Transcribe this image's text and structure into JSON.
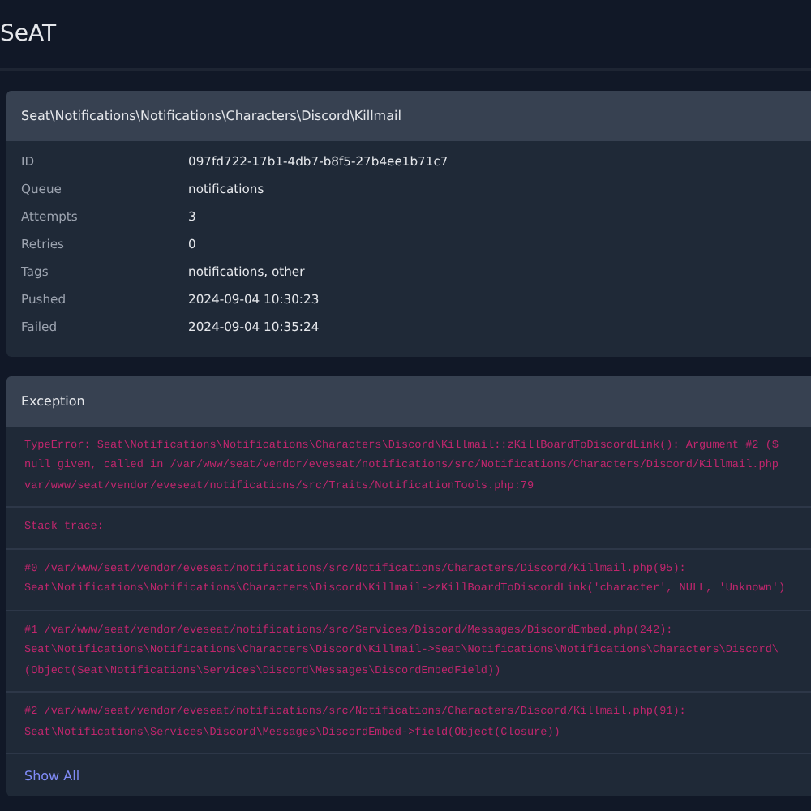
{
  "app_title": "SeAT",
  "job": {
    "title": "Seat\\Notifications\\Notifications\\Characters\\Discord\\Killmail",
    "details": [
      {
        "label": "ID",
        "value": "097fd722-17b1-4db7-b8f5-27b4ee1b71c7"
      },
      {
        "label": "Queue",
        "value": "notifications"
      },
      {
        "label": "Attempts",
        "value": "3"
      },
      {
        "label": "Retries",
        "value": "0"
      },
      {
        "label": "Tags",
        "value": "notifications, other"
      },
      {
        "label": "Pushed",
        "value": "2024-09-04 10:30:23"
      },
      {
        "label": "Failed",
        "value": "2024-09-04 10:35:24"
      }
    ]
  },
  "exception": {
    "title": "Exception",
    "message": [
      "TypeError: Seat\\Notifications\\Notifications\\Characters\\Discord\\Killmail::zKillBoardToDiscordLink(): Argument #2 ($",
      "null given, called in /var/www/seat/vendor/eveseat/notifications/src/Notifications/Characters/Discord/Killmail.php",
      "var/www/seat/vendor/eveseat/notifications/src/Traits/NotificationTools.php:79"
    ],
    "stack_label": "Stack trace:",
    "frames": [
      [
        "#0 /var/www/seat/vendor/eveseat/notifications/src/Notifications/Characters/Discord/Killmail.php(95):",
        "Seat\\Notifications\\Notifications\\Characters\\Discord\\Killmail->zKillBoardToDiscordLink('character', NULL, 'Unknown')"
      ],
      [
        "#1 /var/www/seat/vendor/eveseat/notifications/src/Services/Discord/Messages/DiscordEmbed.php(242):",
        "Seat\\Notifications\\Notifications\\Characters\\Discord\\Killmail->Seat\\Notifications\\Notifications\\Characters\\Discord\\",
        "(Object(Seat\\Notifications\\Services\\Discord\\Messages\\DiscordEmbedField))"
      ],
      [
        "#2 /var/www/seat/vendor/eveseat/notifications/src/Notifications/Characters/Discord/Killmail.php(91):",
        "Seat\\Notifications\\Services\\Discord\\Messages\\DiscordEmbed->field(Object(Closure))"
      ]
    ],
    "show_all": "Show All"
  }
}
